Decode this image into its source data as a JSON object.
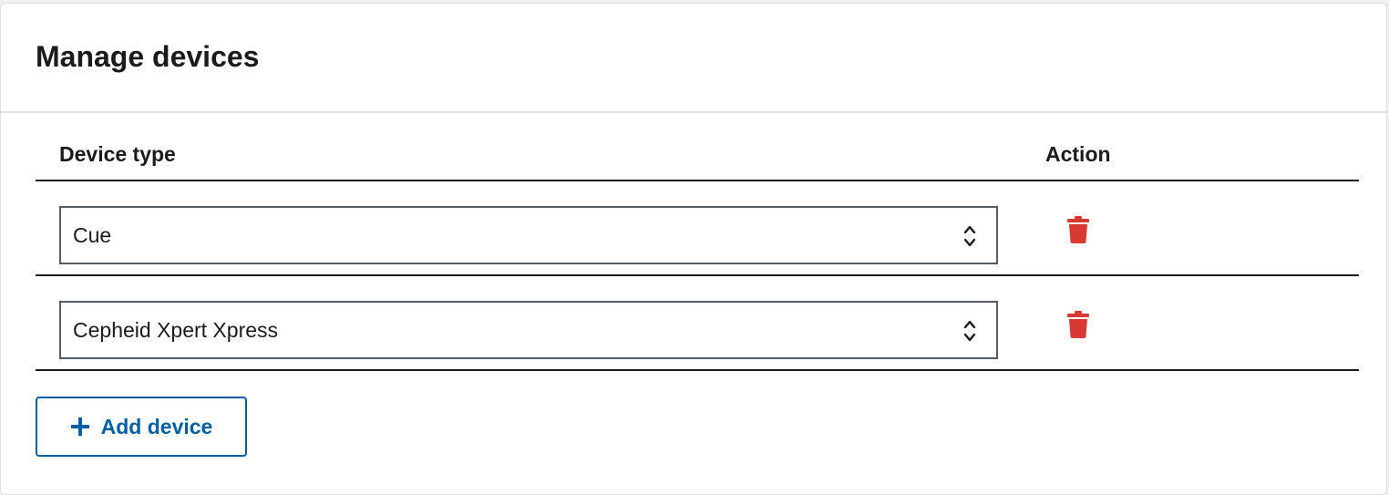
{
  "header": {
    "title": "Manage devices"
  },
  "table": {
    "columns": {
      "device_type": "Device type",
      "action": "Action"
    },
    "rows": [
      {
        "device": "Cue",
        "action_icon": "trash-icon"
      },
      {
        "device": "Cepheid Xpert Xpress",
        "action_icon": "trash-icon"
      }
    ]
  },
  "add_button": {
    "label": "Add device",
    "icon": "plus-icon"
  },
  "colors": {
    "primary": "#005ea2",
    "danger": "#d83933",
    "text": "#1b1b1b",
    "border": "#565c65",
    "divider": "#dfe1e2"
  }
}
